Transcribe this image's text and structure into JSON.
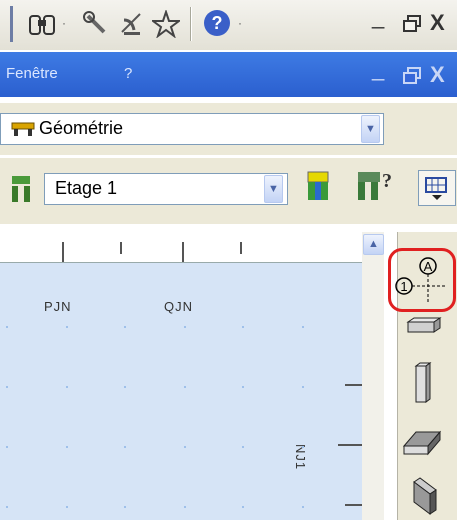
{
  "toolbar": {
    "dropdown_glyph": "·",
    "help_glyph": "?",
    "minimize_glyph": "_",
    "restore_glyph": "🗗",
    "close_glyph": "X"
  },
  "menu": {
    "window_label": "Fenêtre",
    "help_label": "?"
  },
  "geometry_combo": {
    "value": "Géométrie"
  },
  "level_combo": {
    "value": "Etage 1",
    "help_suffix": "?"
  },
  "grid": {
    "col_labels": [
      "PJN",
      "QJN"
    ],
    "row_label": "NJ1"
  },
  "palette": {
    "axis_marker_letter": "A",
    "axis_marker_number": "1"
  },
  "colors": {
    "menubar": "#2b5fcf",
    "canvas": "#d6e4f6",
    "highlight": "#e02020"
  }
}
